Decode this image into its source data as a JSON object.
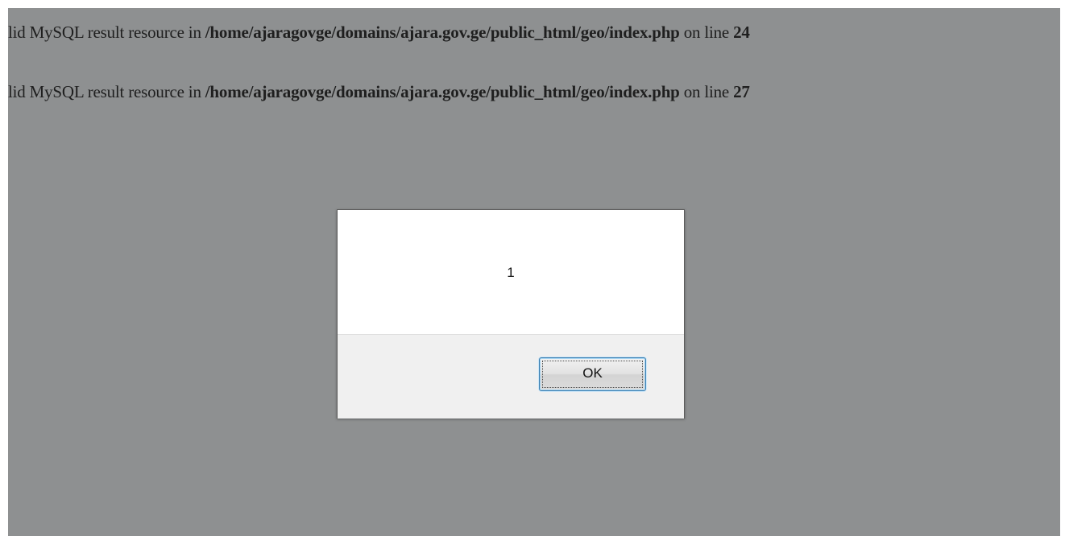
{
  "page": {
    "errors": [
      {
        "prefix": "lid MySQL result resource in ",
        "path": "/home/ajaragovge/domains/ajara.gov.ge/public_html/geo/index.php",
        "middle": " on line ",
        "line": "24"
      },
      {
        "prefix": "lid MySQL result resource in ",
        "path": "/home/ajaragovge/domains/ajara.gov.ge/public_html/geo/index.php",
        "middle": " on line ",
        "line": "27"
      }
    ]
  },
  "dialog": {
    "message": "1",
    "ok_label": "OK"
  },
  "colors": {
    "overlay": "#8e9091",
    "dialog_bg": "#ffffff",
    "footer_bg": "#f0f0f0",
    "button_focus_border": "#3c7fb1"
  }
}
